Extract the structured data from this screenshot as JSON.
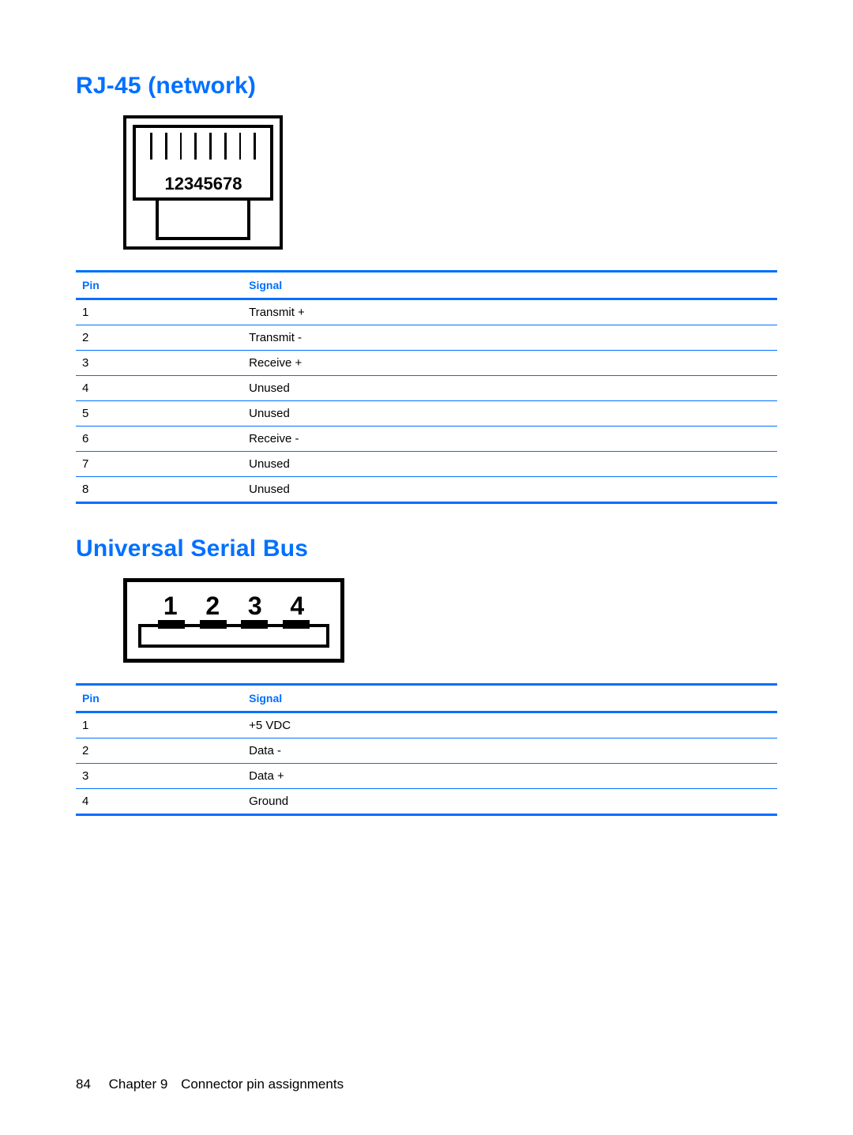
{
  "sections": {
    "rj45": {
      "title": "RJ-45 (network)",
      "diagram_pins": [
        "1",
        "2",
        "3",
        "4",
        "5",
        "6",
        "7",
        "8"
      ],
      "headers": {
        "pin": "Pin",
        "signal": "Signal"
      },
      "rows": [
        {
          "pin": "1",
          "signal": "Transmit +"
        },
        {
          "pin": "2",
          "signal": "Transmit -"
        },
        {
          "pin": "3",
          "signal": "Receive +"
        },
        {
          "pin": "4",
          "signal": "Unused"
        },
        {
          "pin": "5",
          "signal": "Unused"
        },
        {
          "pin": "6",
          "signal": "Receive -"
        },
        {
          "pin": "7",
          "signal": "Unused"
        },
        {
          "pin": "8",
          "signal": "Unused"
        }
      ]
    },
    "usb": {
      "title": "Universal Serial Bus",
      "diagram_pins": [
        "1",
        "2",
        "3",
        "4"
      ],
      "headers": {
        "pin": "Pin",
        "signal": "Signal"
      },
      "rows": [
        {
          "pin": "1",
          "signal": "+5 VDC"
        },
        {
          "pin": "2",
          "signal": "Data -"
        },
        {
          "pin": "3",
          "signal": "Data +"
        },
        {
          "pin": "4",
          "signal": "Ground"
        }
      ]
    }
  },
  "footer": {
    "page_number": "84",
    "chapter": "Chapter 9",
    "chapter_title": "Connector pin assignments"
  }
}
